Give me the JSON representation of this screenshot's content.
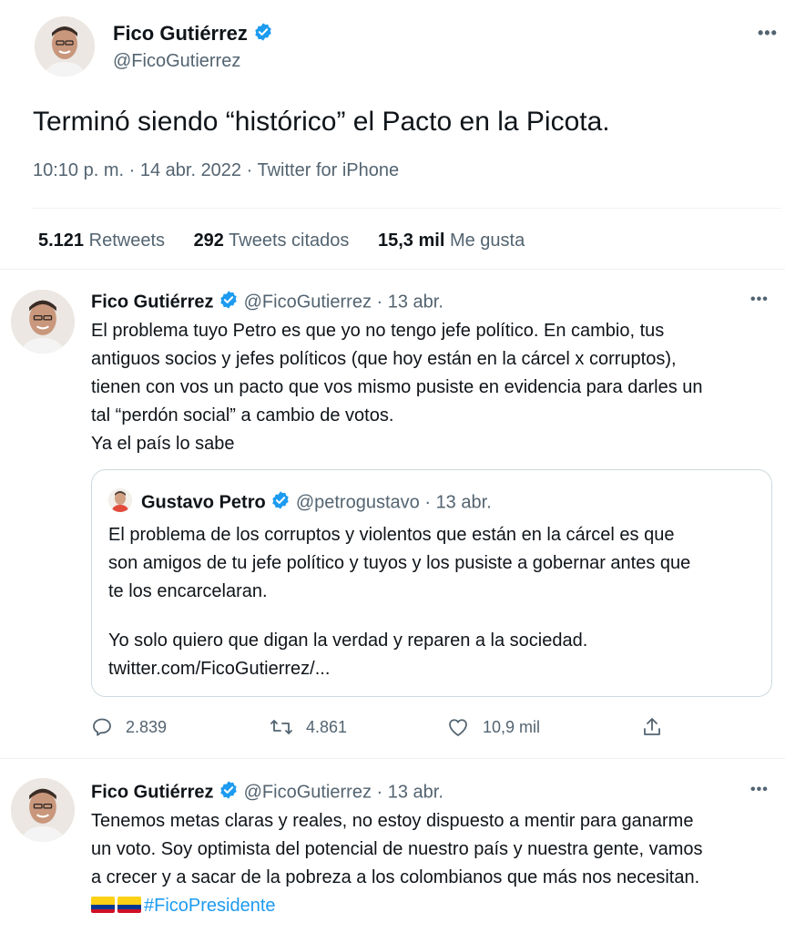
{
  "main_tweet": {
    "author_name": "Fico Gutiérrez",
    "author_handle": "@FicoGutierrez",
    "text": "Terminó siendo “histórico” el Pacto en la Picota.",
    "time": "10:10 p. m.",
    "date": "14 abr. 2022",
    "source": "Twitter for iPhone",
    "meta_separator": " · ",
    "stats": {
      "retweets_num": "5.121",
      "retweets_label": "Retweets",
      "quotes_num": "292",
      "quotes_label": "Tweets citados",
      "likes_num": "15,3 mil",
      "likes_label": "Me gusta"
    },
    "more_icon": "ellipsis-icon"
  },
  "reply1": {
    "author_name": "Fico Gutiérrez",
    "author_handle": "@FicoGutierrez",
    "date": "13 abr.",
    "lines": [
      "El problema tuyo Petro es que yo no tengo jefe político. En cambio, tus",
      "antiguos socios y jefes políticos (que hoy están en la cárcel x corruptos),",
      "tienen con vos un pacto que vos mismo pusiste en evidencia para darles un",
      "tal “perdón social” a cambio de votos.",
      "Ya el país lo sabe"
    ],
    "quote": {
      "author_name": "Gustavo Petro",
      "author_handle": "@petrogustavo",
      "date": "13 abr.",
      "lines1": [
        "El problema de los corruptos y violentos que están en la cárcel es que",
        "son amigos de tu jefe político y tuyos y los pusiste a gobernar antes que",
        "te los encarcelaran."
      ],
      "lines2": [
        "Yo solo quiero que digan la verdad y reparen a la sociedad.",
        "twitter.com/FicoGutierrez/..."
      ]
    },
    "actions": {
      "replies": "2.839",
      "retweets": "4.861",
      "likes": "10,9 mil"
    }
  },
  "reply2": {
    "author_name": "Fico Gutiérrez",
    "author_handle": "@FicoGutierrez",
    "date": "13 abr.",
    "lines": [
      "Tenemos metas claras y reales, no estoy dispuesto a mentir para ganarme",
      "un voto. Soy optimista del potencial de nuestro país y nuestra gente, vamos",
      "a crecer y a sacar de la pobreza a los colombianos que más nos necesitan."
    ],
    "hashtag": "#FicoPresidente"
  },
  "colors": {
    "accent": "#1d9bf0",
    "text": "#0f1419",
    "muted": "#536471",
    "border": "#cfd9de"
  }
}
